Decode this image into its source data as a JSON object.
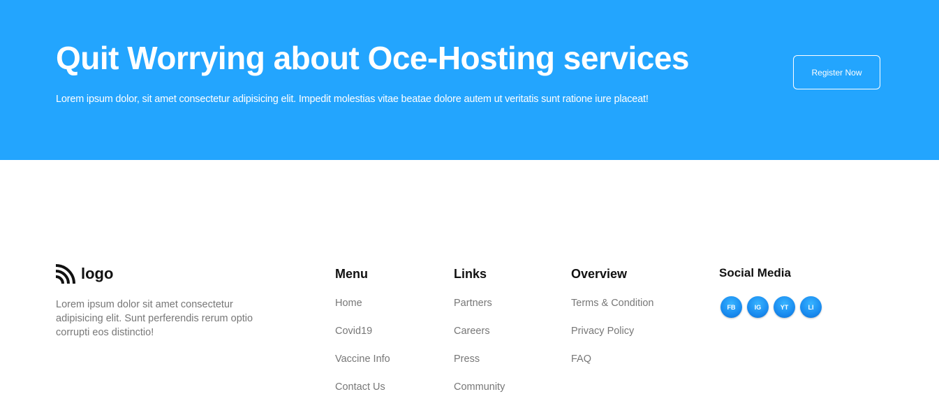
{
  "cta": {
    "title": "Quit Worrying about Oce-Hosting services",
    "subtitle": "Lorem ipsum dolor, sit amet consectetur adipisicing elit. Impedit molestias vitae beatae dolore autem ut veritatis sunt ratione iure placeat!",
    "button_label": "Register Now",
    "background_color": "#23a5fe"
  },
  "footer": {
    "brand": {
      "icon": "wifi-signal-icon",
      "name": "logo"
    },
    "about": "Lorem ipsum dolor sit amet consectetur adipisicing elit. Sunt perferendis rerum optio corrupti eos distinctio!",
    "columns": [
      {
        "title": "Menu",
        "items": [
          "Home",
          "Covid19",
          "Vaccine Info",
          "Contact Us"
        ]
      },
      {
        "title": "Links",
        "items": [
          "Partners",
          "Careers",
          "Press",
          "Community"
        ]
      },
      {
        "title": "Overview",
        "items": [
          "Terms & Condition",
          "Privacy Policy",
          "FAQ"
        ]
      }
    ],
    "social": {
      "title": "Social Media",
      "icons": [
        {
          "label": "FB",
          "icon": "facebook-icon"
        },
        {
          "label": "IG",
          "icon": "instagram-icon"
        },
        {
          "label": "YT",
          "icon": "youtube-icon"
        },
        {
          "label": "LI",
          "icon": "linkedin-icon"
        }
      ]
    }
  }
}
